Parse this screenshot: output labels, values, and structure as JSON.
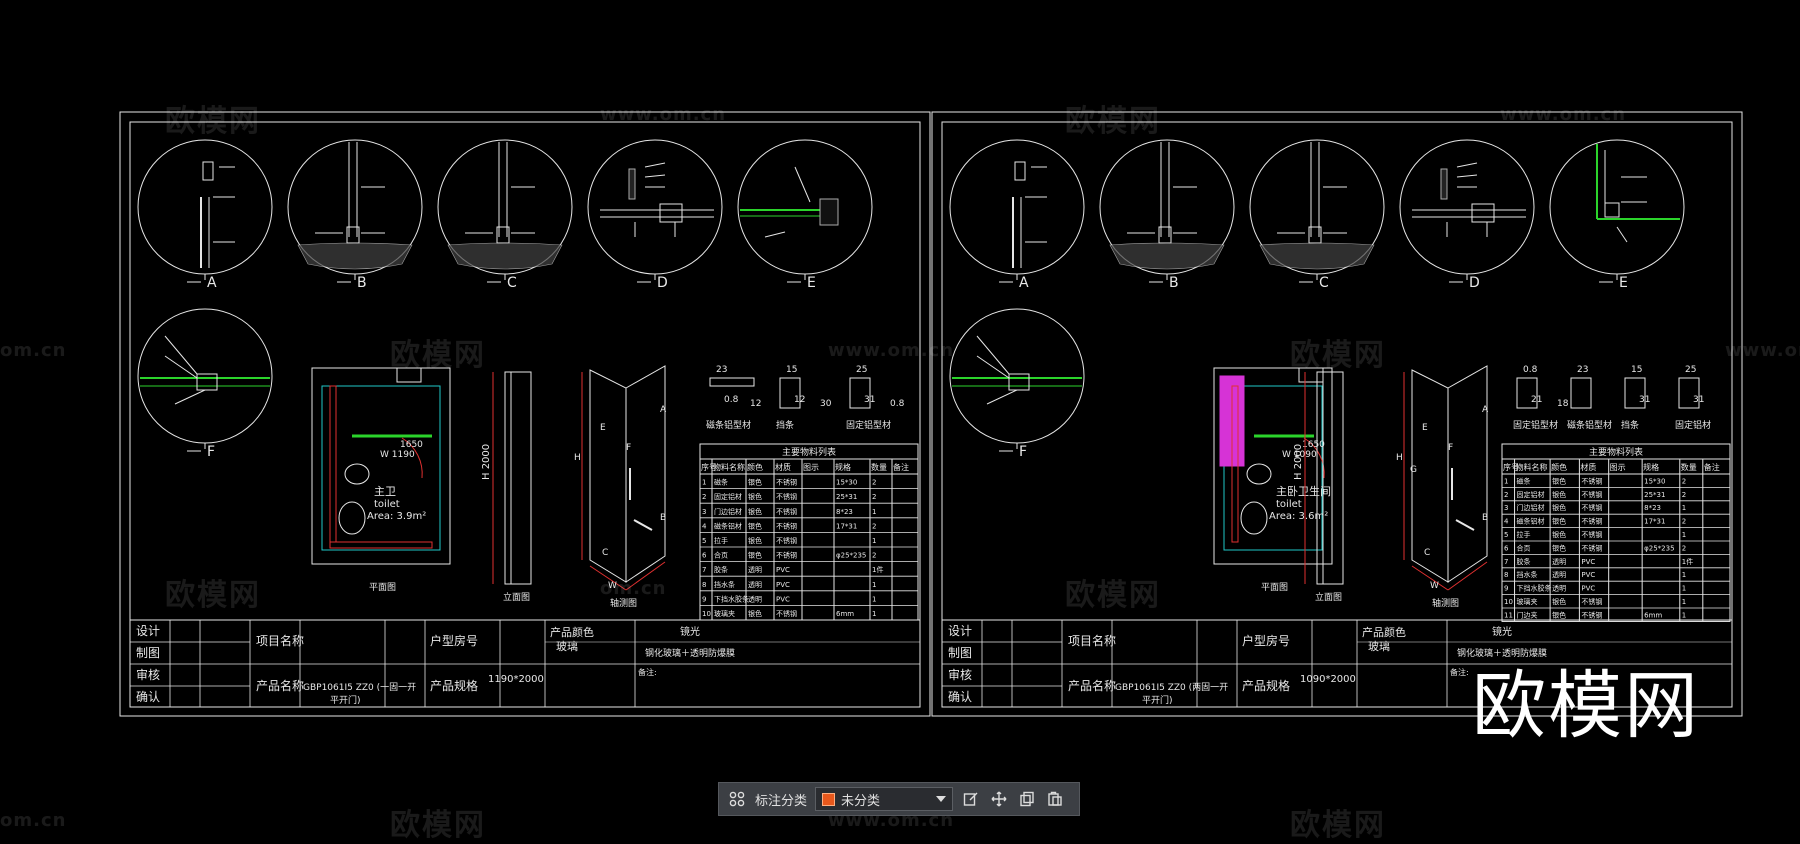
{
  "colors": {
    "background": "#000000",
    "line": "#e6e6e6",
    "green": "#2bd42b",
    "magenta": "#d633d6",
    "red": "#e03030",
    "yellow": "#e6e600",
    "cyan": "#20c8c8",
    "accent": "#e8581c"
  },
  "watermarks": {
    "brand": "欧模网",
    "url": "www.om.cn",
    "url_short": "om.cn"
  },
  "big_watermark": "欧模网",
  "detail_labels": [
    "A",
    "B",
    "C",
    "D",
    "E",
    "F"
  ],
  "sheet_left": {
    "profiles": [
      {
        "dims": [
          "23",
          "0.8",
          "12"
        ],
        "label": "磁条铝型材"
      },
      {
        "dims": [
          "15",
          "12",
          "30"
        ],
        "label": "挡条"
      },
      {
        "dims": [
          "25",
          "31",
          "0.8"
        ],
        "label": "固定铝型材"
      }
    ],
    "plan": {
      "dim": "1650",
      "dim_w": "W 1190",
      "room_cn": "主卫",
      "room_en": "toilet",
      "area": "Area: 3.9m²",
      "caption": "平面图"
    },
    "elevation": {
      "height": "H 2000",
      "caption": "立面图"
    },
    "axon": {
      "caption": "轴测图",
      "h": "H",
      "w": "W",
      "a": "A",
      "b": "B",
      "c": "C",
      "e": "E",
      "f": "F"
    },
    "table": {
      "title": "主要物料列表",
      "headers": [
        "序号",
        "物料名称",
        "颜色",
        "材质",
        "图示",
        "规格",
        "数量",
        "备注"
      ],
      "rows": [
        [
          "1",
          "磁条",
          "银色",
          "不锈钢",
          "",
          "15*30",
          "2",
          ""
        ],
        [
          "2",
          "固定铝材",
          "银色",
          "不锈钢",
          "",
          "25*31",
          "2",
          ""
        ],
        [
          "3",
          "门边铝材",
          "银色",
          "不锈钢",
          "",
          "8*23",
          "1",
          ""
        ],
        [
          "4",
          "磁条铝材",
          "银色",
          "不锈钢",
          "",
          "17*31",
          "2",
          ""
        ],
        [
          "5",
          "拉手",
          "银色",
          "不锈钢",
          "",
          "",
          "1",
          ""
        ],
        [
          "6",
          "合页",
          "银色",
          "不锈钢",
          "",
          "φ25*235",
          "2",
          ""
        ],
        [
          "7",
          "胶条",
          "透明",
          "PVC",
          "",
          "",
          "1件",
          ""
        ],
        [
          "8",
          "挡水条",
          "透明",
          "PVC",
          "",
          "",
          "1",
          ""
        ],
        [
          "9",
          "下挡水胶条",
          "透明",
          "PVC",
          "",
          "",
          "1",
          ""
        ],
        [
          "10",
          "玻璃夹",
          "银色",
          "不锈钢",
          "",
          "6mm",
          "1",
          ""
        ]
      ]
    },
    "title_block": {
      "row_labels": [
        "设计",
        "制图",
        "审核",
        "确认"
      ],
      "project_name_label": "项目名称",
      "house_no_label": "户型房号",
      "product_color_label": "产品颜色",
      "glass_label": "玻璃",
      "color_value": "镜光",
      "glass_value": "钢化玻璃＋透明防爆膜",
      "product_name_label": "产品名称",
      "product_name": "GBP1061I5 ZZ0 (一固一开",
      "product_name_2": "平开门)",
      "spec_label": "产品规格",
      "spec_value": "1190*2000",
      "remark_label": "备注:"
    }
  },
  "sheet_right": {
    "profiles": [
      {
        "dims": [
          "0.8",
          "21",
          "18"
        ],
        "label": "固定铝型材"
      },
      {
        "dims": [
          "23"
        ],
        "label": "磁条铝型材"
      },
      {
        "dims": [
          "15",
          "31"
        ],
        "label": "挡条"
      },
      {
        "dims": [
          "25",
          "31"
        ],
        "label": "固定铝材"
      }
    ],
    "plan": {
      "dim": "1650",
      "dim_w": "W 1090",
      "room_cn": "主卧卫生间",
      "room_en": "toilet",
      "area": "Area: 3.6m²",
      "caption": "平面图"
    },
    "elevation": {
      "height": "H 2000",
      "caption": "立面图"
    },
    "axon": {
      "caption": "轴测图",
      "h": "H",
      "w": "W",
      "a": "A",
      "b": "B",
      "c": "C",
      "e": "E",
      "f": "F",
      "g": "G"
    },
    "table": {
      "title": "主要物料列表",
      "headers": [
        "序号",
        "物料名称",
        "颜色",
        "材质",
        "图示",
        "规格",
        "数量",
        "备注"
      ],
      "rows": [
        [
          "1",
          "磁条",
          "银色",
          "不锈钢",
          "",
          "15*30",
          "2",
          ""
        ],
        [
          "2",
          "固定铝材",
          "银色",
          "不锈钢",
          "",
          "25*31",
          "2",
          ""
        ],
        [
          "3",
          "门边铝材",
          "银色",
          "不锈钢",
          "",
          "8*23",
          "1",
          ""
        ],
        [
          "4",
          "磁条铝材",
          "银色",
          "不锈钢",
          "",
          "17*31",
          "2",
          ""
        ],
        [
          "5",
          "拉手",
          "银色",
          "不锈钢",
          "",
          "",
          "1",
          ""
        ],
        [
          "6",
          "合页",
          "银色",
          "不锈钢",
          "",
          "φ25*235",
          "2",
          ""
        ],
        [
          "7",
          "胶条",
          "透明",
          "PVC",
          "",
          "",
          "1件",
          ""
        ],
        [
          "8",
          "挡水条",
          "透明",
          "PVC",
          "",
          "",
          "1",
          ""
        ],
        [
          "9",
          "下挡水胶条",
          "透明",
          "PVC",
          "",
          "",
          "1",
          ""
        ],
        [
          "10",
          "玻璃夹",
          "银色",
          "不锈钢",
          "",
          "",
          "1",
          ""
        ],
        [
          "11",
          "门边夹",
          "银色",
          "不锈钢",
          "",
          "6mm",
          "1",
          ""
        ]
      ]
    },
    "title_block": {
      "row_labels": [
        "设计",
        "制图",
        "审核",
        "确认"
      ],
      "project_name_label": "项目名称",
      "house_no_label": "户型房号",
      "product_color_label": "产品颜色",
      "glass_label": "玻璃",
      "color_value": "镜光",
      "glass_value": "钢化玻璃＋透明防爆膜",
      "product_name_label": "产品名称",
      "product_name": "GBP1061I5 ZZ0 (两固一开",
      "product_name_2": "平开门)",
      "spec_label": "产品规格",
      "spec_value": "1090*2000",
      "remark_label": "备注:"
    }
  },
  "toolbar": {
    "label": "标注分类",
    "select_value": "未分类",
    "icons": [
      "grid-icon",
      "edit-icon",
      "move-icon",
      "copy-icon",
      "paste-icon"
    ]
  }
}
